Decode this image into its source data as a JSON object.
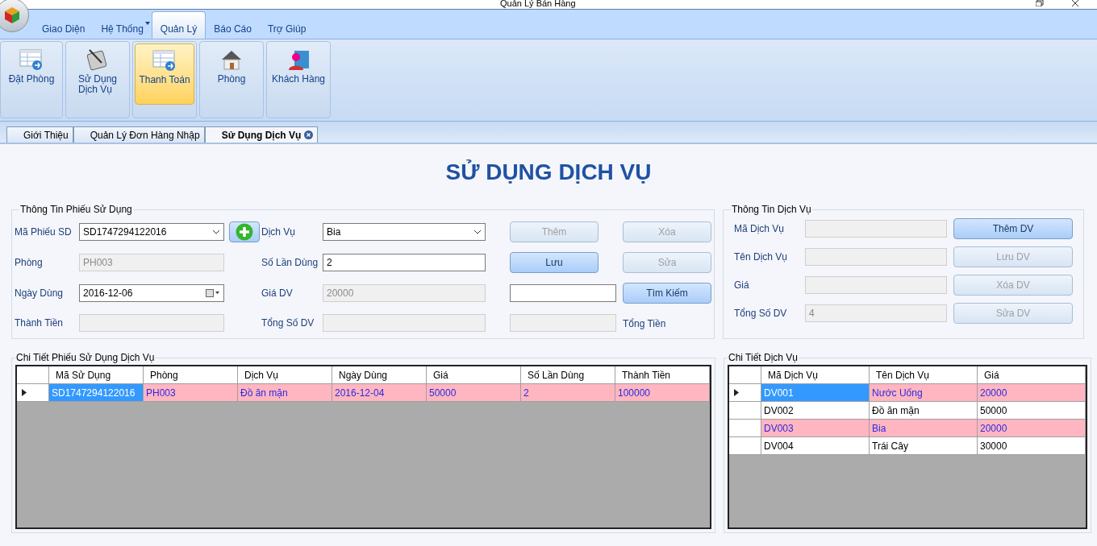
{
  "window": {
    "title": "Quản Lý Bán Hàng"
  },
  "ribbon_tabs": [
    {
      "label": "Giao Diện",
      "selected": false,
      "has_menu": false
    },
    {
      "label": "Hệ Thống",
      "selected": false,
      "has_menu": true
    },
    {
      "label": "Quản Lý",
      "selected": true,
      "has_menu": false
    },
    {
      "label": "Báo Cáo",
      "selected": false,
      "has_menu": false
    },
    {
      "label": "Trợ Giúp",
      "selected": false,
      "has_menu": false
    }
  ],
  "ribbon_buttons": [
    {
      "label": "Đặt Phòng",
      "selected": false
    },
    {
      "label": "Sử Dụng\nDịch Vụ",
      "selected": false
    },
    {
      "label": "Thanh Toán",
      "selected": true
    },
    {
      "label": "Phòng",
      "selected": false
    },
    {
      "label": "Khách Hàng",
      "selected": false
    }
  ],
  "document_tabs": [
    {
      "label": "Giới Thiệu",
      "selected": false
    },
    {
      "label": "Quản Lý Đơn Hàng Nhập",
      "selected": false
    },
    {
      "label": "Sử Dụng Dịch Vụ",
      "selected": true
    }
  ],
  "heading": "SỬ DỤNG DỊCH VỤ",
  "receipt_info": {
    "title": "Thông Tin Phiếu Sử Dụng",
    "fields": [
      {
        "label": "Mã Phiếu SD",
        "value": "SD1747294122016",
        "kind": "combo",
        "disabled": false
      },
      {
        "label": "Phòng",
        "value": "PH003",
        "kind": "text",
        "disabled": true
      },
      {
        "label": "Ngày Dùng",
        "value": "2016-12-06",
        "kind": "date",
        "disabled": false
      },
      {
        "label": "Thành Tiền",
        "kind": "text",
        "disabled": true
      },
      {
        "label": "Dịch Vụ",
        "value": "Bia",
        "kind": "combo",
        "disabled": false
      },
      {
        "label": "Số Lần Dùng",
        "value": "2",
        "kind": "text",
        "disabled": false
      },
      {
        "label": "Giá DV",
        "value": "20000",
        "kind": "text",
        "disabled": true
      },
      {
        "label": "Tổng Số DV",
        "kind": "text",
        "disabled": true
      }
    ],
    "buttons": [
      {
        "label": "Thêm",
        "disabled": true
      },
      {
        "label": "Xóa",
        "disabled": true
      },
      {
        "label": "Lưu",
        "disabled": false
      },
      {
        "label": "Sửa",
        "disabled": true
      },
      {
        "label": "Tìm Kiếm",
        "disabled": false
      }
    ],
    "search_field": {
      "disabled": false
    },
    "total_field": {
      "disabled": true
    },
    "total_label": "Tổng Tiền"
  },
  "service_info": {
    "title": "Thông Tin Dịch Vụ",
    "fields": [
      {
        "label": "Mã Dịch Vụ",
        "disabled": true
      },
      {
        "label": "Tên Dịch Vụ",
        "disabled": true
      },
      {
        "label": "Giá",
        "disabled": true
      },
      {
        "label": "Tổng Số DV",
        "value": "4",
        "disabled": true
      }
    ],
    "buttons": [
      {
        "label": "Thêm DV",
        "disabled": false
      },
      {
        "label": "Lưu DV",
        "disabled": true
      },
      {
        "label": "Xóa DV",
        "disabled": true
      },
      {
        "label": "Sửa DV",
        "disabled": true
      }
    ]
  },
  "receipt_details": {
    "title": "Chi Tiết Phiếu Sử Dụng Dịch Vụ",
    "columns": [
      "Mã Sử Dụng",
      "Phòng",
      "Dịch Vụ",
      "Ngày Dùng",
      "Giá",
      "Số Lần Dùng",
      "Thành Tiền"
    ],
    "rows": [
      {
        "selected": true,
        "highlighted": true,
        "cells": [
          "SD1747294122016",
          "PH003",
          "Đồ ăn mặn",
          "2016-12-04",
          "50000",
          "2",
          "100000"
        ]
      }
    ]
  },
  "service_details": {
    "title": "Chi Tiết Dịch Vụ",
    "columns": [
      "Mã Dịch Vụ",
      "Tên Dịch Vụ",
      "Giá"
    ],
    "rows": [
      {
        "selected": true,
        "highlighted": true,
        "cells": [
          "DV001",
          "Nước Uống",
          "20000"
        ]
      },
      {
        "selected": false,
        "highlighted": false,
        "cells": [
          "DV002",
          "Đồ ăn mặn",
          "50000"
        ]
      },
      {
        "selected": false,
        "highlighted": true,
        "cells": [
          "DV003",
          "Bia",
          "20000"
        ]
      },
      {
        "selected": false,
        "highlighted": false,
        "cells": [
          "DV004",
          "Trái Cây",
          "30000"
        ]
      }
    ]
  }
}
